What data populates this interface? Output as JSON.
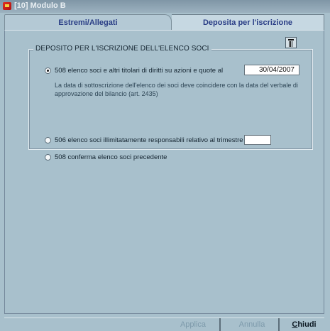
{
  "window": {
    "title": "[10] Modulo B",
    "icon": "app-icon"
  },
  "tabs": [
    {
      "label": "Estremi/Allegati",
      "active": false
    },
    {
      "label": "Deposita per l'iscrizione",
      "active": true
    }
  ],
  "toolbar": {
    "delete_icon": "trash-icon"
  },
  "section": {
    "legend": "DEPOSITO PER L'ISCRIZIONE DELL'ELENCO SOCI",
    "options": [
      {
        "label": "508 elenco soci e altri titolari di diritti su azioni e quote al",
        "checked": true
      },
      {
        "label": "506 elenco soci illimitatamente responsabili relativo al trimestre",
        "checked": false
      },
      {
        "label": "508 conferma elenco soci precedente",
        "checked": false
      }
    ],
    "date_value": "30/04/2007",
    "trimestre_value": "",
    "note": "La data di sottoscrizione dell'elenco dei soci deve coincidere con la data del verbale di approvazione del bilancio (art. 2435)"
  },
  "buttons": {
    "applica": "Applica",
    "annulla": "Annulla",
    "chiudi_first": "C",
    "chiudi_rest": "hiudi"
  },
  "colors": {
    "background": "#a8c0cc",
    "tab_text": "#2a3e86"
  }
}
